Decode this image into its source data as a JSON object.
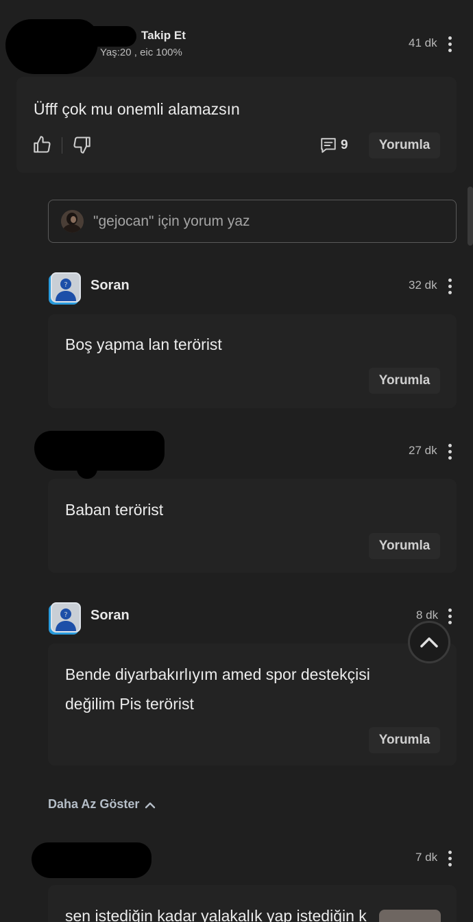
{
  "post": {
    "follow_label": "Takip Et",
    "meta": "Yaş:20 , eic 100%",
    "time": "41 dk",
    "text": "Üfff çok mu onemli alamazsın",
    "comment_count": "9",
    "reply_label": "Yorumla"
  },
  "reply_input": {
    "placeholder": "\"gejocan\" için yorum yaz"
  },
  "comments": [
    {
      "author": "Soran",
      "time": "32 dk",
      "text": "Boş yapma lan terörist",
      "reply_label": "Yorumla"
    },
    {
      "author": "",
      "time": "27 dk",
      "text": "Baban terörist",
      "reply_label": "Yorumla"
    },
    {
      "author": "Soran",
      "time": "8 dk",
      "text_line1": "Bende diyarbakırlıyım amed spor destekçisi",
      "text_line2": "değilim Pis terörist",
      "reply_label": "Yorumla"
    }
  ],
  "show_less_label": "Daha Az Göster",
  "next_post": {
    "time": "7 dk",
    "text_partial": "sen istediğin kadar yalakalık yap istediğin k"
  },
  "icons": [
    "thumbs-up-icon",
    "thumbs-down-icon",
    "comment-icon",
    "kebab-icon",
    "chevron-up-icon",
    "avatar-icon"
  ],
  "colors": {
    "background": "#1f1f1f",
    "card": "#232323",
    "button": "#2a2a2a",
    "accent": "#2a9bdc"
  }
}
